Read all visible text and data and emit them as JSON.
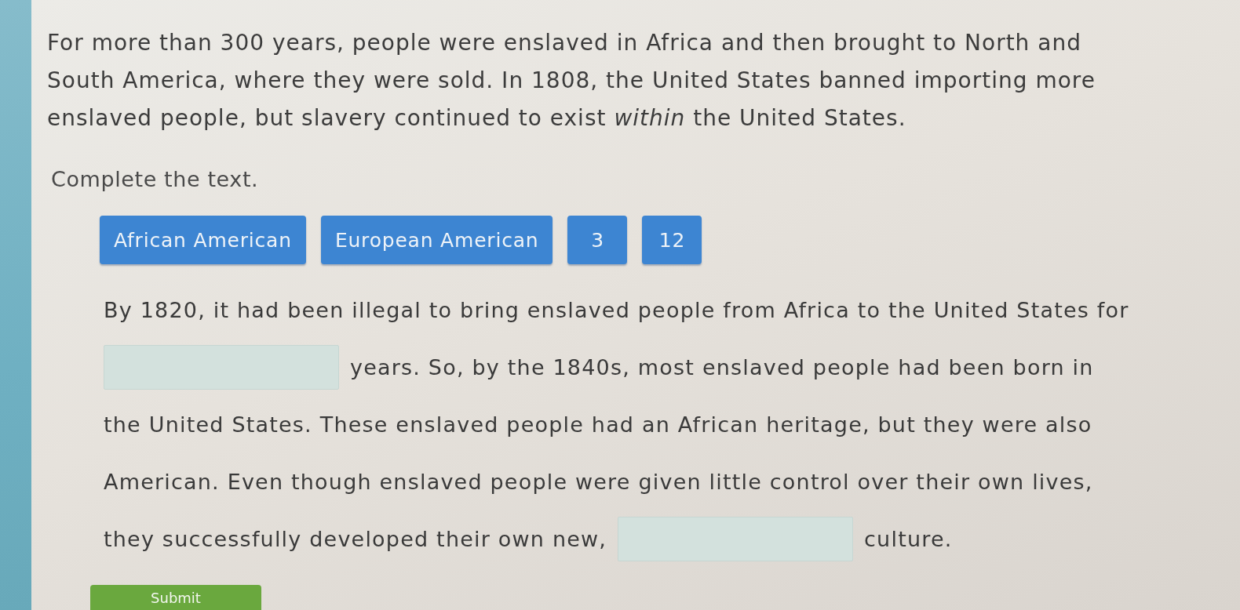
{
  "intro": {
    "text": "For more than 300 years, people were enslaved in Africa and then brought to North and South America, where they were sold. In 1808, the United States banned importing more enslaved people, but slavery continued to exist *within* the United States."
  },
  "instruction": "Complete the text.",
  "word_bank": [
    {
      "label": "African American"
    },
    {
      "label": "European American"
    },
    {
      "label": "3"
    },
    {
      "label": "12"
    }
  ],
  "passage": {
    "lines": [
      [
        {
          "kind": "text",
          "text": "By 1820, it had been illegal to bring enslaved people from Africa to the United States for"
        }
      ],
      [
        {
          "kind": "blank"
        },
        {
          "kind": "text",
          "text": "years. So, by the 1840s, most enslaved people had been born in"
        }
      ],
      [
        {
          "kind": "text",
          "text": "the United States. These enslaved people had an African heritage, but they were also"
        }
      ],
      [
        {
          "kind": "text",
          "text": "American. Even though enslaved people were given little control over their own lives,"
        }
      ],
      [
        {
          "kind": "text",
          "text": "they successfully developed their own new,"
        },
        {
          "kind": "blank"
        },
        {
          "kind": "text",
          "text": "culture."
        }
      ]
    ]
  },
  "submit_button": {
    "label": "Submit"
  }
}
